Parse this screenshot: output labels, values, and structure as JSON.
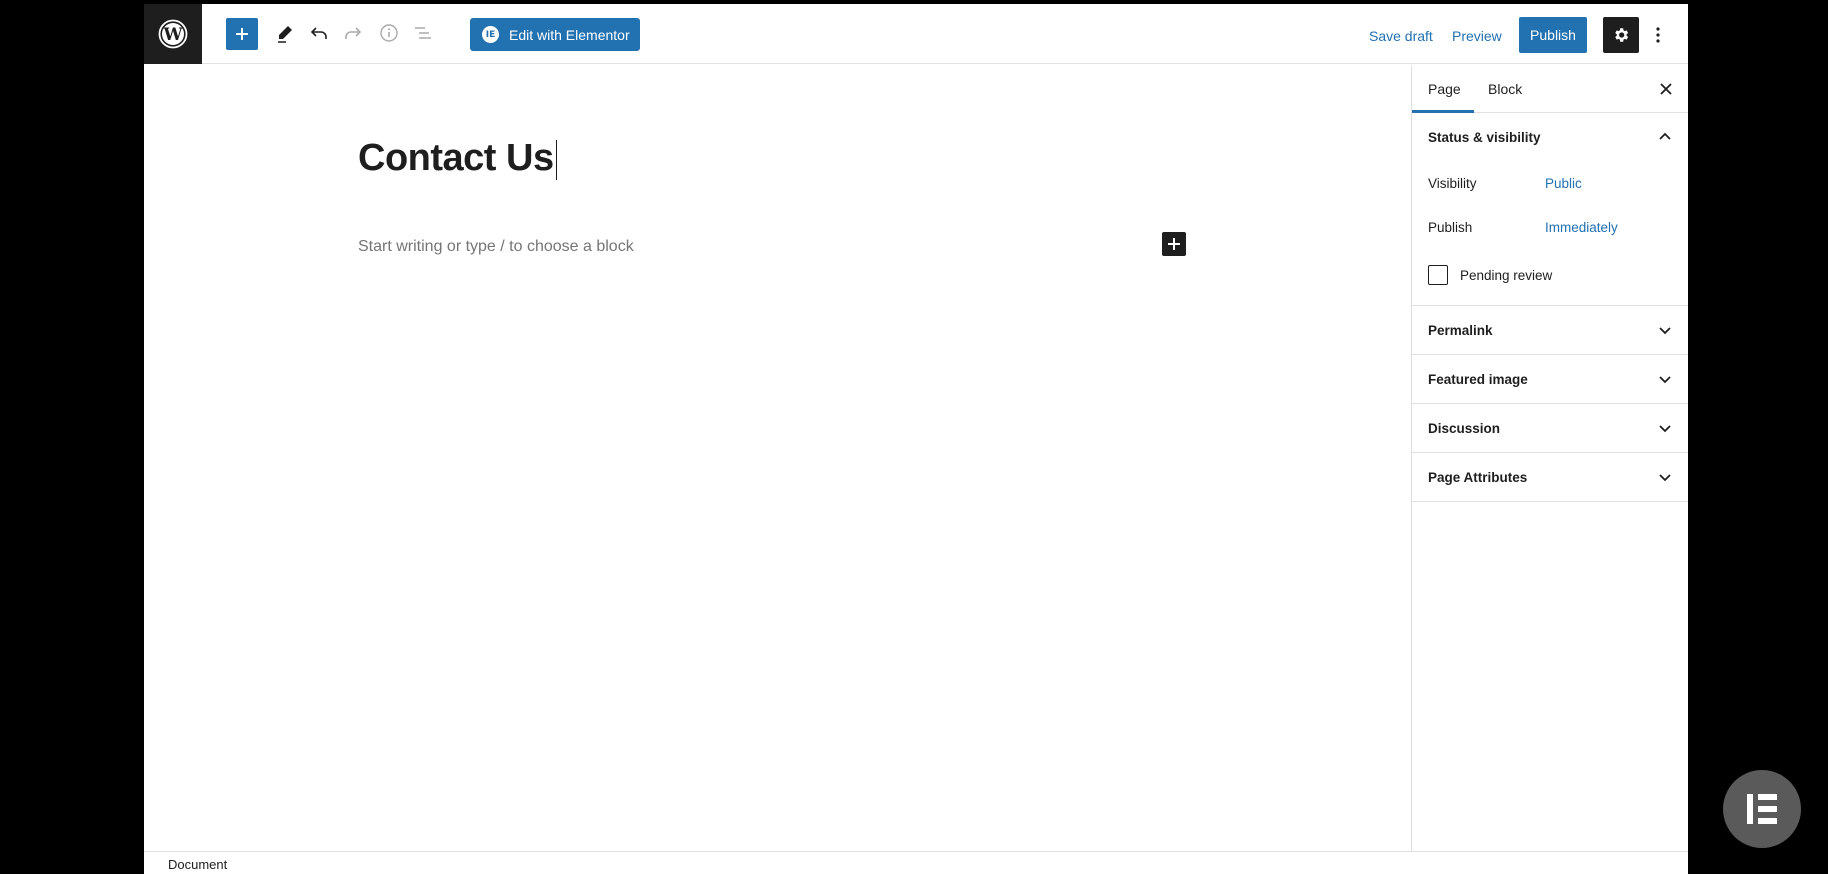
{
  "toolbar": {
    "edit_with_elementor_label": "Edit with Elementor",
    "elementor_badge": "IE",
    "save_draft_label": "Save draft",
    "preview_label": "Preview",
    "publish_label": "Publish"
  },
  "editor": {
    "title": "Contact Us",
    "block_placeholder": "Start writing or type / to choose a block"
  },
  "sidebar": {
    "tabs": [
      {
        "label": "Page",
        "active": true
      },
      {
        "label": "Block",
        "active": false
      }
    ],
    "status_visibility": {
      "title": "Status & visibility",
      "visibility_label": "Visibility",
      "visibility_value": "Public",
      "publish_label": "Publish",
      "publish_value": "Immediately",
      "pending_review_label": "Pending review",
      "pending_review_checked": false
    },
    "panels": [
      {
        "label": "Permalink"
      },
      {
        "label": "Featured image"
      },
      {
        "label": "Discussion"
      },
      {
        "label": "Page Attributes"
      }
    ]
  },
  "footer": {
    "breadcrumb": "Document"
  },
  "colors": {
    "accent": "#2271b1",
    "dark": "#1e1e1e",
    "elementor_fab": "#5a5a5a"
  }
}
